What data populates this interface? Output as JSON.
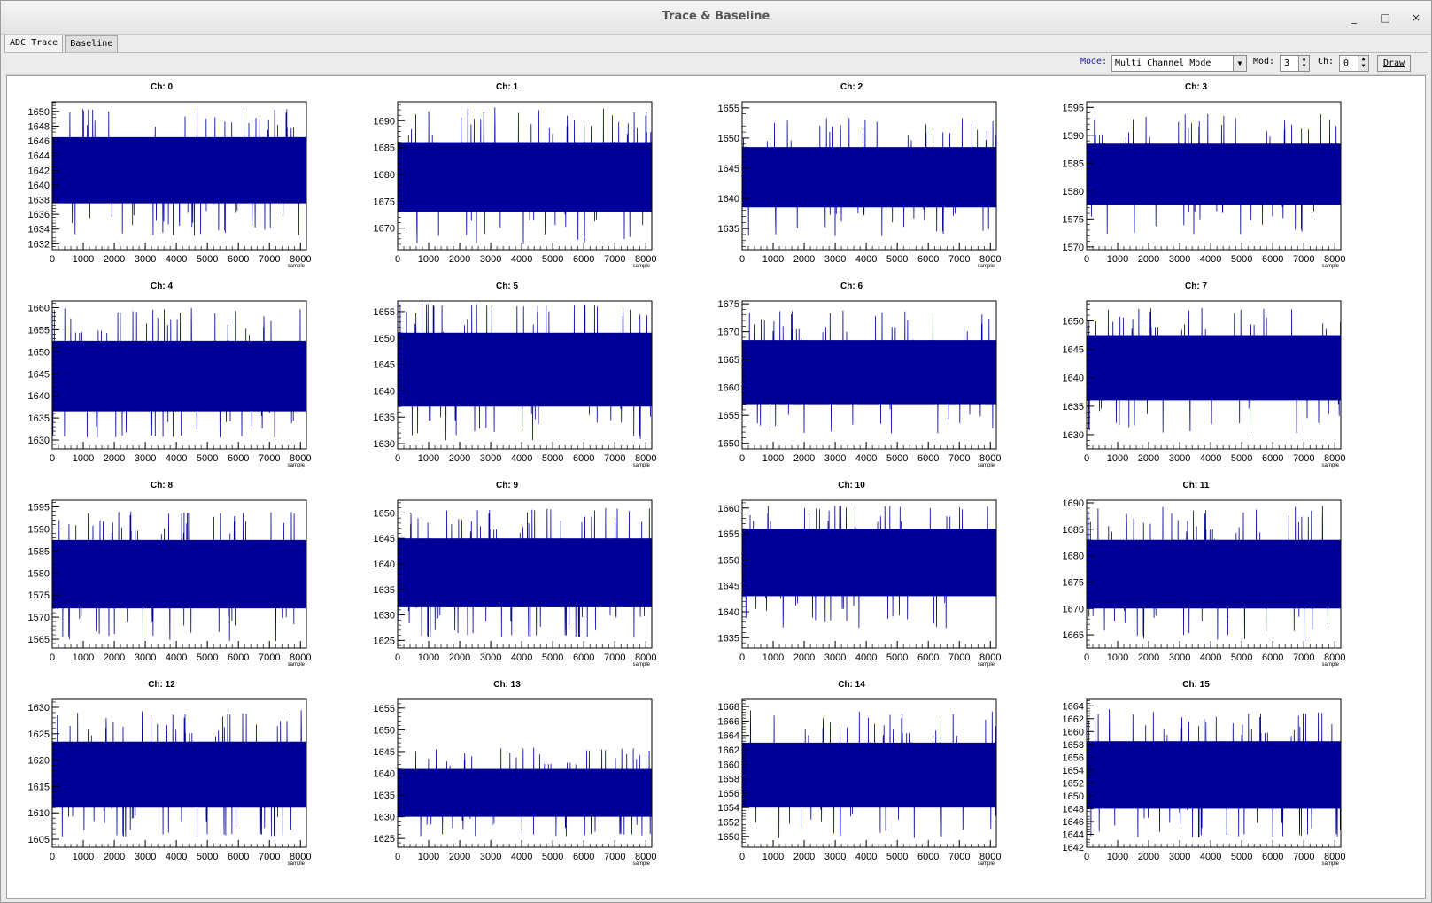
{
  "window": {
    "title": "Trace & Baseline",
    "controls": {
      "minimize": "_",
      "maximize": "□",
      "close": "×"
    }
  },
  "tabs": [
    {
      "label": "ADC Trace",
      "active": true
    },
    {
      "label": "Baseline",
      "active": false
    }
  ],
  "toolbar": {
    "mode_label": "Mode:",
    "mode_value": "Multi Channel Mode",
    "mod_label": "Mod:",
    "mod_value": "3",
    "ch_label": "Ch:",
    "ch_value": "0",
    "draw_label": "Draw"
  },
  "colors": {
    "trace": "#000099",
    "mode_label": "#1a1aa6"
  },
  "chart_data": [
    {
      "type": "line",
      "title": "Ch: 0",
      "xlabel": "sample",
      "xlim": [
        0,
        8192
      ],
      "xticks": [
        0,
        1000,
        2000,
        3000,
        4000,
        5000,
        6000,
        7000,
        8000
      ],
      "ylim": [
        1631.2,
        1651.3
      ],
      "yticks": [
        1632,
        1634,
        1636,
        1638,
        1640,
        1642,
        1644,
        1646,
        1648,
        1650
      ],
      "baseline": 1641.9,
      "band": [
        1637.5,
        1646.5
      ],
      "spikes": [
        1633,
        1650.5
      ]
    },
    {
      "type": "line",
      "title": "Ch: 1",
      "xlabel": "sample",
      "xlim": [
        0,
        8192
      ],
      "xticks": [
        0,
        1000,
        2000,
        3000,
        4000,
        5000,
        6000,
        7000,
        8000
      ],
      "ylim": [
        1666,
        1693.5
      ],
      "yticks": [
        1670,
        1675,
        1680,
        1685,
        1690
      ],
      "baseline": 1679.5,
      "band": [
        1673,
        1686
      ],
      "spikes": [
        1667,
        1692.5
      ]
    },
    {
      "type": "line",
      "title": "Ch: 2",
      "xlabel": "sample",
      "xlim": [
        0,
        8192
      ],
      "xticks": [
        0,
        1000,
        2000,
        3000,
        4000,
        5000,
        6000,
        7000,
        8000
      ],
      "ylim": [
        1631.5,
        1656
      ],
      "yticks": [
        1635,
        1640,
        1645,
        1650,
        1655
      ],
      "baseline": 1643.5,
      "band": [
        1638.5,
        1648.5
      ],
      "spikes": [
        1633,
        1655
      ]
    },
    {
      "type": "line",
      "title": "Ch: 3",
      "xlabel": "sample",
      "xlim": [
        0,
        8192
      ],
      "xticks": [
        0,
        1000,
        2000,
        3000,
        4000,
        5000,
        6000,
        7000,
        8000
      ],
      "ylim": [
        1569.5,
        1596
      ],
      "yticks": [
        1570,
        1575,
        1580,
        1585,
        1590,
        1595
      ],
      "baseline": 1583,
      "band": [
        1577.5,
        1588.5
      ],
      "spikes": [
        1571,
        1595
      ]
    },
    {
      "type": "line",
      "title": "Ch: 4",
      "xlabel": "sample",
      "xlim": [
        0,
        8192
      ],
      "xticks": [
        0,
        1000,
        2000,
        3000,
        4000,
        5000,
        6000,
        7000,
        8000
      ],
      "ylim": [
        1628,
        1661.5
      ],
      "yticks": [
        1630,
        1635,
        1640,
        1645,
        1650,
        1655,
        1660
      ],
      "baseline": 1644,
      "band": [
        1636.5,
        1652.5
      ],
      "spikes": [
        1630.5,
        1660
      ]
    },
    {
      "type": "line",
      "title": "Ch: 5",
      "xlabel": "sample",
      "xlim": [
        0,
        8192
      ],
      "xticks": [
        0,
        1000,
        2000,
        3000,
        4000,
        5000,
        6000,
        7000,
        8000
      ],
      "ylim": [
        1629,
        1657
      ],
      "yticks": [
        1630,
        1635,
        1640,
        1645,
        1650,
        1655
      ],
      "baseline": 1644,
      "band": [
        1637,
        1651
      ],
      "spikes": [
        1630.5,
        1656.5
      ]
    },
    {
      "type": "line",
      "title": "Ch: 6",
      "xlabel": "sample",
      "xlim": [
        0,
        8192
      ],
      "xticks": [
        0,
        1000,
        2000,
        3000,
        4000,
        5000,
        6000,
        7000,
        8000
      ],
      "ylim": [
        1649,
        1675.5
      ],
      "yticks": [
        1650,
        1655,
        1660,
        1665,
        1670,
        1675
      ],
      "baseline": 1663,
      "band": [
        1657,
        1668.5
      ],
      "spikes": [
        1650,
        1674
      ]
    },
    {
      "type": "line",
      "title": "Ch: 7",
      "xlabel": "sample",
      "xlim": [
        0,
        8192
      ],
      "xticks": [
        0,
        1000,
        2000,
        3000,
        4000,
        5000,
        6000,
        7000,
        8000
      ],
      "ylim": [
        1627.5,
        1653.5
      ],
      "yticks": [
        1630,
        1635,
        1640,
        1645,
        1650
      ],
      "baseline": 1641.5,
      "band": [
        1636,
        1647.5
      ],
      "spikes": [
        1629,
        1652.5
      ]
    },
    {
      "type": "line",
      "title": "Ch: 8",
      "xlabel": "sample",
      "xlim": [
        0,
        8192
      ],
      "xticks": [
        0,
        1000,
        2000,
        3000,
        4000,
        5000,
        6000,
        7000,
        8000
      ],
      "ylim": [
        1563,
        1596.5
      ],
      "yticks": [
        1565,
        1570,
        1575,
        1580,
        1585,
        1590,
        1595
      ],
      "baseline": 1579.5,
      "band": [
        1572,
        1587.5
      ],
      "spikes": [
        1564.5,
        1594
      ]
    },
    {
      "type": "line",
      "title": "Ch: 9",
      "xlabel": "sample",
      "xlim": [
        0,
        8192
      ],
      "xticks": [
        0,
        1000,
        2000,
        3000,
        4000,
        5000,
        6000,
        7000,
        8000
      ],
      "ylim": [
        1623.5,
        1652.5
      ],
      "yticks": [
        1625,
        1630,
        1635,
        1640,
        1645,
        1650
      ],
      "baseline": 1638,
      "band": [
        1631.5,
        1645
      ],
      "spikes": [
        1625.5,
        1651
      ]
    },
    {
      "type": "line",
      "title": "Ch: 10",
      "xlabel": "sample",
      "xlim": [
        0,
        8192
      ],
      "xticks": [
        0,
        1000,
        2000,
        3000,
        4000,
        5000,
        6000,
        7000,
        8000
      ],
      "ylim": [
        1633,
        1661.5
      ],
      "yticks": [
        1635,
        1640,
        1645,
        1650,
        1655,
        1660
      ],
      "baseline": 1649.5,
      "band": [
        1643,
        1656
      ],
      "spikes": [
        1634.5,
        1660.5
      ]
    },
    {
      "type": "line",
      "title": "Ch: 11",
      "xlabel": "sample",
      "xlim": [
        0,
        8192
      ],
      "xticks": [
        0,
        1000,
        2000,
        3000,
        4000,
        5000,
        6000,
        7000,
        8000
      ],
      "ylim": [
        1662.5,
        1690.5
      ],
      "yticks": [
        1665,
        1670,
        1675,
        1680,
        1685,
        1690
      ],
      "baseline": 1676.5,
      "band": [
        1670,
        1683
      ],
      "spikes": [
        1664,
        1689.5
      ]
    },
    {
      "type": "line",
      "title": "Ch: 12",
      "xlabel": "sample",
      "xlim": [
        0,
        8192
      ],
      "xticks": [
        0,
        1000,
        2000,
        3000,
        4000,
        5000,
        6000,
        7000,
        8000
      ],
      "ylim": [
        1603.5,
        1631.5
      ],
      "yticks": [
        1605,
        1610,
        1615,
        1620,
        1625,
        1630
      ],
      "baseline": 1617,
      "band": [
        1611,
        1623.5
      ],
      "spikes": [
        1605.5,
        1630
      ]
    },
    {
      "type": "line",
      "title": "Ch: 13",
      "xlabel": "sample",
      "xlim": [
        0,
        8192
      ],
      "xticks": [
        0,
        1000,
        2000,
        3000,
        4000,
        5000,
        6000,
        7000,
        8000
      ],
      "ylim": [
        1623,
        1657
      ],
      "yticks": [
        1625,
        1630,
        1635,
        1640,
        1645,
        1650,
        1655
      ],
      "baseline": 1635,
      "band": [
        1630,
        1641
      ],
      "spikes": [
        1625.5,
        1655
      ]
    },
    {
      "type": "line",
      "title": "Ch: 14",
      "xlabel": "sample",
      "xlim": [
        0,
        8192
      ],
      "xticks": [
        0,
        1000,
        2000,
        3000,
        4000,
        5000,
        6000,
        7000,
        8000
      ],
      "ylim": [
        1648.5,
        1669
      ],
      "yticks": [
        1650,
        1652,
        1654,
        1656,
        1658,
        1660,
        1662,
        1664,
        1666,
        1668
      ],
      "baseline": 1658.5,
      "band": [
        1654,
        1663
      ],
      "spikes": [
        1649.5,
        1667.5
      ]
    },
    {
      "type": "line",
      "title": "Ch: 15",
      "xlabel": "sample",
      "xlim": [
        0,
        8192
      ],
      "xticks": [
        0,
        1000,
        2000,
        3000,
        4000,
        5000,
        6000,
        7000,
        8000
      ],
      "ylim": [
        1642,
        1665
      ],
      "yticks": [
        1642,
        1644,
        1646,
        1648,
        1650,
        1652,
        1654,
        1656,
        1658,
        1660,
        1662,
        1664
      ],
      "baseline": 1653,
      "band": [
        1648,
        1658.5
      ],
      "spikes": [
        1643.5,
        1663.5
      ]
    }
  ]
}
